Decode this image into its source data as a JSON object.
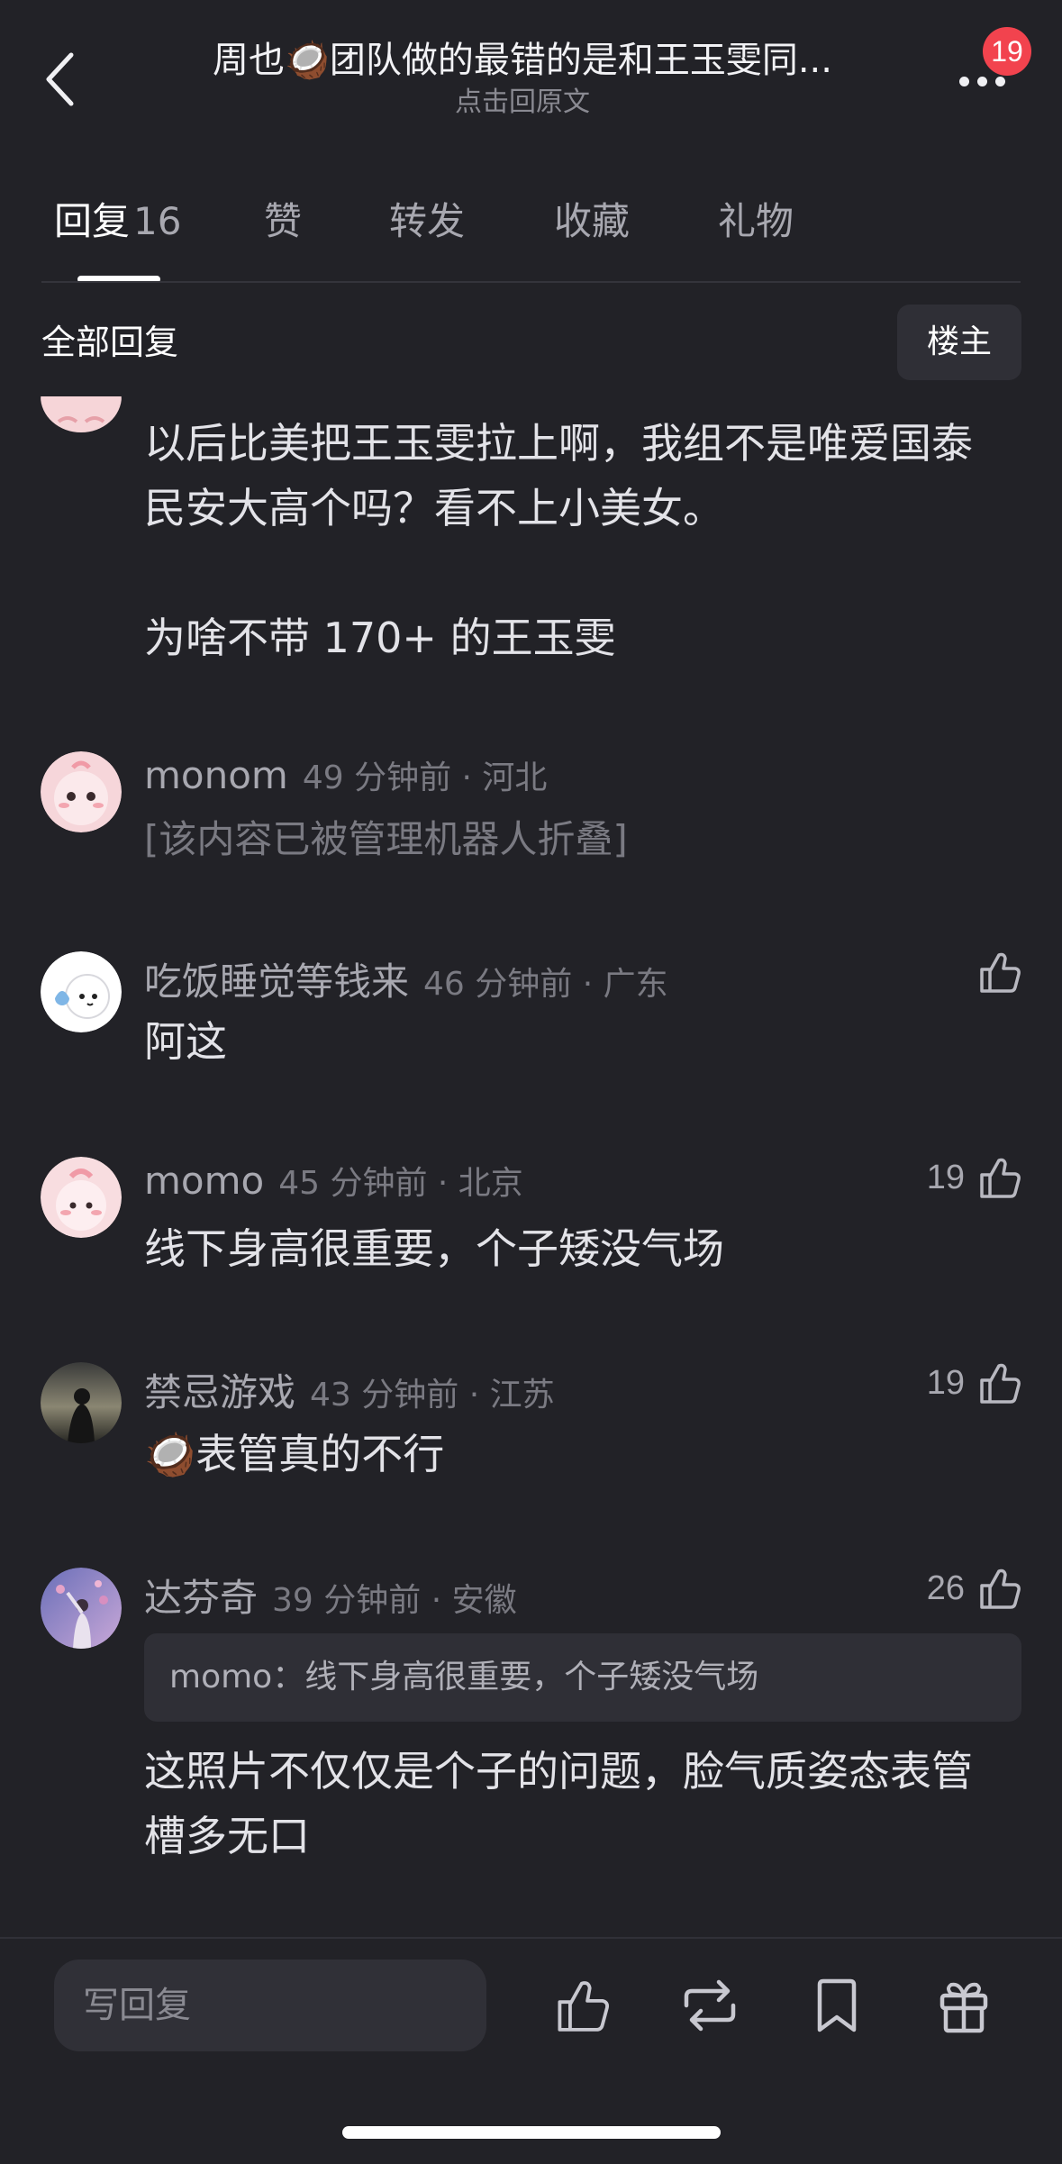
{
  "header": {
    "title": "周也🥥团队做的最错的是和王玉雯同...",
    "subtitle": "点击回原文",
    "notification_count": "19"
  },
  "tabs": [
    {
      "label": "回复",
      "count": "16"
    },
    {
      "label": "赞"
    },
    {
      "label": "转发"
    },
    {
      "label": "收藏"
    },
    {
      "label": "礼物"
    }
  ],
  "filter": {
    "title": "全部回复",
    "op_button": "楼主"
  },
  "comments": [
    {
      "text_lines": [
        "以后比美把王玉雯拉上啊，我组不是唯爱国泰",
        "民安大高个吗？看不上小美女。"
      ],
      "text2": "为啥不带 170+ 的王玉雯"
    },
    {
      "username": "monom",
      "time_location": "49 分钟前 · 河北",
      "text": "[该内容已被管理机器人折叠]"
    },
    {
      "username": "吃饭睡觉等钱来",
      "time_location": "46 分钟前 · 广东",
      "text": "阿这"
    },
    {
      "username": "momo",
      "time_location": "45 分钟前 · 北京",
      "text": "线下身高很重要，个子矮没气场",
      "likes": "19"
    },
    {
      "username": "禁忌游戏",
      "time_location": "43 分钟前 · 江苏",
      "text": "🥥表管真的不行",
      "likes": "19"
    },
    {
      "username": "达芬奇",
      "time_location": "39 分钟前 · 安徽",
      "quote": "momo：线下身高很重要，个子矮没气场",
      "text_lines": [
        "这照片不仅仅是个子的问题，脸气质姿态表管",
        "槽多无口"
      ],
      "likes": "26"
    }
  ],
  "bottom_bar": {
    "reply_placeholder": "写回复"
  },
  "icons": [
    "back-icon",
    "more-icon",
    "thumb-up-icon",
    "repost-icon",
    "bookmark-icon",
    "gift-icon"
  ],
  "colors": {
    "background": "#222227",
    "badge": "#f2434e",
    "panel": "#2f2f36"
  }
}
